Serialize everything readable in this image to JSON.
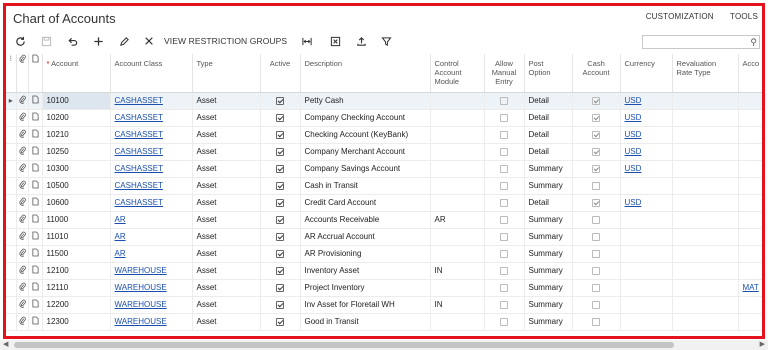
{
  "page_title": "Chart of Accounts",
  "top_links": [
    "CUSTOMIZATION",
    "TOOLS"
  ],
  "toolbar": {
    "view_restriction_groups": "VIEW RESTRICTION GROUPS",
    "search_placeholder": ""
  },
  "columns": {
    "account": "Account",
    "account_class": "Account Class",
    "type": "Type",
    "active": "Active",
    "description": "Description",
    "control_account_module": "Control Account Module",
    "allow_manual_entry": "Allow Manual Entry",
    "post_option": "Post Option",
    "cash_account": "Cash Account",
    "currency": "Currency",
    "revaluation_rate_type": "Revaluation Rate Type",
    "accounting_group": "Acco"
  },
  "rows": [
    {
      "account": "10100",
      "account_class": "CASHASSET",
      "type": "Asset",
      "active": true,
      "description": "Petty Cash",
      "control_module": "",
      "manual_entry": false,
      "post_option": "Detail",
      "cash_account": true,
      "currency": "USD",
      "extra": ""
    },
    {
      "account": "10200",
      "account_class": "CASHASSET",
      "type": "Asset",
      "active": true,
      "description": "Company Checking Account",
      "control_module": "",
      "manual_entry": false,
      "post_option": "Detail",
      "cash_account": true,
      "currency": "USD",
      "extra": ""
    },
    {
      "account": "10210",
      "account_class": "CASHASSET",
      "type": "Asset",
      "active": true,
      "description": "Checking Account (KeyBank)",
      "control_module": "",
      "manual_entry": false,
      "post_option": "Detail",
      "cash_account": true,
      "currency": "USD",
      "extra": ""
    },
    {
      "account": "10250",
      "account_class": "CASHASSET",
      "type": "Asset",
      "active": true,
      "description": "Company Merchant Account",
      "control_module": "",
      "manual_entry": false,
      "post_option": "Detail",
      "cash_account": true,
      "currency": "USD",
      "extra": ""
    },
    {
      "account": "10300",
      "account_class": "CASHASSET",
      "type": "Asset",
      "active": true,
      "description": "Company Savings Account",
      "control_module": "",
      "manual_entry": false,
      "post_option": "Summary",
      "cash_account": true,
      "currency": "USD",
      "extra": ""
    },
    {
      "account": "10500",
      "account_class": "CASHASSET",
      "type": "Asset",
      "active": true,
      "description": "Cash in Transit",
      "control_module": "",
      "manual_entry": false,
      "post_option": "Summary",
      "cash_account": false,
      "currency": "",
      "extra": ""
    },
    {
      "account": "10600",
      "account_class": "CASHASSET",
      "type": "Asset",
      "active": true,
      "description": "Credit Card Account",
      "control_module": "",
      "manual_entry": false,
      "post_option": "Detail",
      "cash_account": true,
      "currency": "USD",
      "extra": ""
    },
    {
      "account": "11000",
      "account_class": "AR",
      "type": "Asset",
      "active": true,
      "description": "Accounts Receivable",
      "control_module": "AR",
      "manual_entry": false,
      "post_option": "Summary",
      "cash_account": false,
      "currency": "",
      "extra": ""
    },
    {
      "account": "11010",
      "account_class": "AR",
      "type": "Asset",
      "active": true,
      "description": "AR Accrual Account",
      "control_module": "",
      "manual_entry": false,
      "post_option": "Summary",
      "cash_account": false,
      "currency": "",
      "extra": ""
    },
    {
      "account": "11500",
      "account_class": "AR",
      "type": "Asset",
      "active": true,
      "description": "AR Provisioning",
      "control_module": "",
      "manual_entry": false,
      "post_option": "Summary",
      "cash_account": false,
      "currency": "",
      "extra": ""
    },
    {
      "account": "12100",
      "account_class": "WAREHOUSE",
      "type": "Asset",
      "active": true,
      "description": "Inventory Asset",
      "control_module": "IN",
      "manual_entry": false,
      "post_option": "Summary",
      "cash_account": false,
      "currency": "",
      "extra": ""
    },
    {
      "account": "12110",
      "account_class": "WAREHOUSE",
      "type": "Asset",
      "active": true,
      "description": "Project Inventory",
      "control_module": "",
      "manual_entry": false,
      "post_option": "Summary",
      "cash_account": false,
      "currency": "",
      "extra": "MAT"
    },
    {
      "account": "12200",
      "account_class": "WAREHOUSE",
      "type": "Asset",
      "active": true,
      "description": "Inv Asset for Floretail WH",
      "control_module": "IN",
      "manual_entry": false,
      "post_option": "Summary",
      "cash_account": false,
      "currency": "",
      "extra": ""
    },
    {
      "account": "12300",
      "account_class": "WAREHOUSE",
      "type": "Asset",
      "active": true,
      "description": "Good in Transit",
      "control_module": "",
      "manual_entry": false,
      "post_option": "Summary",
      "cash_account": false,
      "currency": "",
      "extra": ""
    }
  ],
  "colors": {
    "frame": "#e3121c",
    "link": "#1a4fb0",
    "selected_row": "#eef3f8"
  },
  "icons": [
    "refresh-icon",
    "save-icon",
    "undo-icon",
    "plus-icon",
    "edit-icon",
    "close-icon",
    "fit-columns-icon",
    "excel-icon",
    "upload-icon",
    "filter-icon",
    "search-icon",
    "attachment-icon",
    "note-icon"
  ]
}
